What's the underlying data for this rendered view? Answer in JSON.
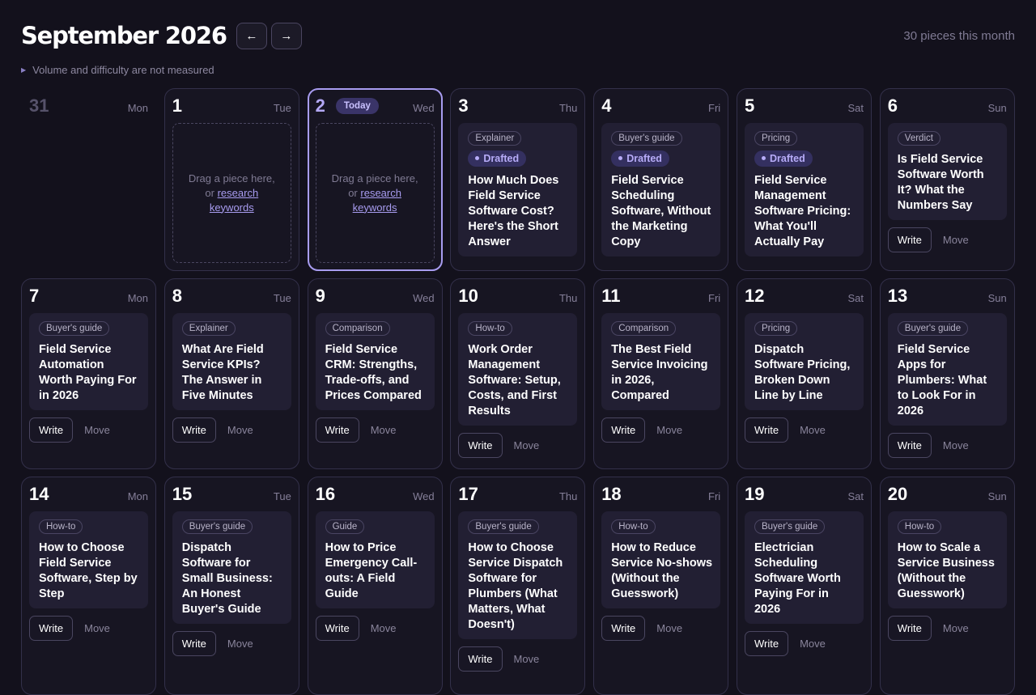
{
  "header": {
    "title": "September 2026",
    "prev_label": "←",
    "next_label": "→",
    "pieces_count": "30 pieces this month"
  },
  "disclosure": {
    "label": "Volume and difficulty are not measured"
  },
  "dropzone": {
    "text": "Drag a piece here,",
    "or": "or",
    "link": "research keywords"
  },
  "labels": {
    "today": "Today",
    "write": "Write",
    "move": "Move",
    "drafted": "Drafted"
  },
  "days": [
    {
      "num": "31",
      "weekday": "Mon",
      "kind": "prev"
    },
    {
      "num": "1",
      "weekday": "Tue",
      "kind": "empty"
    },
    {
      "num": "2",
      "weekday": "Wed",
      "kind": "empty",
      "today": true
    },
    {
      "num": "3",
      "weekday": "Thu",
      "kind": "piece",
      "tag": "Explainer",
      "drafted": true,
      "title": "How Much Does Field Service Software Cost? Here's the Short Answer"
    },
    {
      "num": "4",
      "weekday": "Fri",
      "kind": "piece",
      "tag": "Buyer's guide",
      "drafted": true,
      "title": "Field Service Scheduling Software, Without the Marketing Copy"
    },
    {
      "num": "5",
      "weekday": "Sat",
      "kind": "piece",
      "tag": "Pricing",
      "drafted": true,
      "title": "Field Service Management Software Pricing: What You'll Actually Pay"
    },
    {
      "num": "6",
      "weekday": "Sun",
      "kind": "piece",
      "tag": "Verdict",
      "title": "Is Field Service Software Worth It? What the Numbers Say"
    },
    {
      "num": "7",
      "weekday": "Mon",
      "kind": "piece",
      "tag": "Buyer's guide",
      "title": "Field Service Automation Worth Paying For in 2026"
    },
    {
      "num": "8",
      "weekday": "Tue",
      "kind": "piece",
      "tag": "Explainer",
      "title": "What Are Field Service KPIs? The Answer in Five Minutes"
    },
    {
      "num": "9",
      "weekday": "Wed",
      "kind": "piece",
      "tag": "Comparison",
      "title": "Field Service CRM: Strengths, Trade-offs, and Prices Compared"
    },
    {
      "num": "10",
      "weekday": "Thu",
      "kind": "piece",
      "tag": "How-to",
      "title": "Work Order Management Software: Setup, Costs, and First Results"
    },
    {
      "num": "11",
      "weekday": "Fri",
      "kind": "piece",
      "tag": "Comparison",
      "title": "The Best Field Service Invoicing in 2026, Compared"
    },
    {
      "num": "12",
      "weekday": "Sat",
      "kind": "piece",
      "tag": "Pricing",
      "title": "Dispatch Software Pricing, Broken Down Line by Line"
    },
    {
      "num": "13",
      "weekday": "Sun",
      "kind": "piece",
      "tag": "Buyer's guide",
      "title": "Field Service Apps for Plumbers: What to Look For in 2026"
    },
    {
      "num": "14",
      "weekday": "Mon",
      "kind": "piece",
      "tag": "How-to",
      "title": "How to Choose Field Service Software, Step by Step"
    },
    {
      "num": "15",
      "weekday": "Tue",
      "kind": "piece",
      "tag": "Buyer's guide",
      "title": "Dispatch Software for Small Business: An Honest Buyer's Guide"
    },
    {
      "num": "16",
      "weekday": "Wed",
      "kind": "piece",
      "tag": "Guide",
      "title": "How to Price Emergency Call-outs: A Field Guide"
    },
    {
      "num": "17",
      "weekday": "Thu",
      "kind": "piece",
      "tag": "Buyer's guide",
      "title": "How to Choose Service Dispatch Software for Plumbers (What Matters, What Doesn't)"
    },
    {
      "num": "18",
      "weekday": "Fri",
      "kind": "piece",
      "tag": "How-to",
      "title": "How to Reduce Service No-shows (Without the Guesswork)"
    },
    {
      "num": "19",
      "weekday": "Sat",
      "kind": "piece",
      "tag": "Buyer's guide",
      "title": "Electrician Scheduling Software Worth Paying For in 2026"
    },
    {
      "num": "20",
      "weekday": "Sun",
      "kind": "piece",
      "tag": "How-to",
      "title": "How to Scale a Service Business (Without the Guesswork)"
    }
  ]
}
